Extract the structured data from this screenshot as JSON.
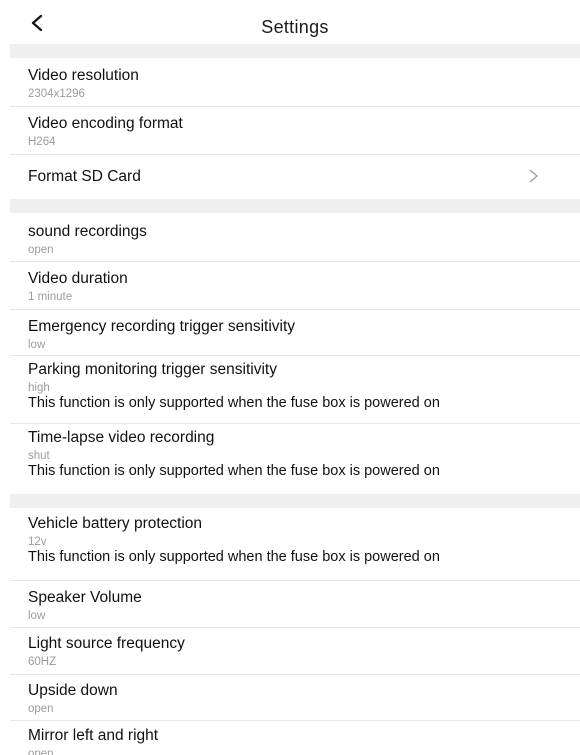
{
  "header": {
    "title": "Settings",
    "back_icon": "chevron-left-icon"
  },
  "groups": [
    {
      "items": [
        {
          "title": "Video resolution",
          "value": "2304x1296"
        },
        {
          "title": "Video encoding format",
          "value": "H264"
        },
        {
          "title": "Format SD Card",
          "action_icon": "chevron-right-icon"
        }
      ]
    },
    {
      "items": [
        {
          "title": "sound recordings",
          "value": "open"
        },
        {
          "title": "Video duration",
          "value": "1 minute"
        },
        {
          "title": "Emergency recording trigger sensitivity",
          "value": "low"
        },
        {
          "title": "Parking monitoring trigger sensitivity",
          "value": "high",
          "note": "This function is only supported when the fuse box is powered on"
        },
        {
          "title": "Time-lapse video recording",
          "value": "shut",
          "note": "This function is only supported when the fuse box is powered on"
        }
      ]
    },
    {
      "items": [
        {
          "title": "Vehicle battery protection",
          "value": "12v",
          "note": "This function is only supported when the fuse box is powered on"
        },
        {
          "title": "Speaker Volume",
          "value": "low"
        },
        {
          "title": "Light source frequency",
          "value": "60HZ"
        },
        {
          "title": "Upside down",
          "value": "open"
        },
        {
          "title": "Mirror left and right",
          "value": "open"
        }
      ]
    }
  ],
  "colors": {
    "background": "#ffffff",
    "separator": "#efefef",
    "title_text": "#111111",
    "value_text": "#9c9c9c",
    "chevron": "#9a9a9a"
  }
}
